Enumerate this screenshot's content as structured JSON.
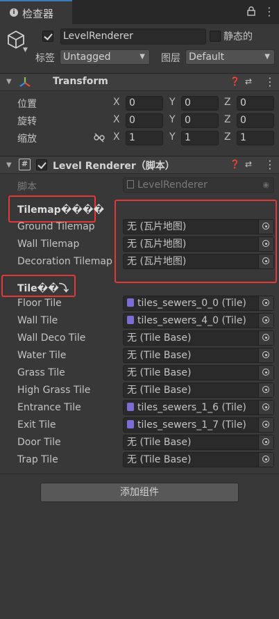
{
  "tab": {
    "title": "检查器"
  },
  "object": {
    "name": "LevelRenderer",
    "active": true,
    "static_label": "静态的",
    "tag_label": "标签",
    "tag_value": "Untagged",
    "layer_label": "图层",
    "layer_value": "Default"
  },
  "transform": {
    "title": "Transform",
    "rows": [
      {
        "label": "位置",
        "x": "0",
        "y": "0",
        "z": "0"
      },
      {
        "label": "旋转",
        "x": "0",
        "y": "0",
        "z": "0"
      },
      {
        "label": "缩放",
        "x": "1",
        "y": "1",
        "z": "1"
      }
    ]
  },
  "axis": {
    "x": "X",
    "y": "Y",
    "z": "Z"
  },
  "level_renderer": {
    "title": "Level Renderer（脚本）",
    "script_label": "脚本",
    "script_value": "LevelRenderer",
    "header_tilemap": "Tilemap����",
    "header_tile": "Tile��⤵",
    "tilemap_fields": [
      {
        "label": "Ground Tilemap",
        "value": "无 (瓦片地图)"
      },
      {
        "label": "Wall Tilemap",
        "value": "无 (瓦片地图)"
      },
      {
        "label": "Decoration Tilemap",
        "value": "无 (瓦片地图)"
      }
    ],
    "tile_fields": [
      {
        "label": "Floor Tile",
        "value": "tiles_sewers_0_0 (Tile)",
        "assigned": true
      },
      {
        "label": "Wall Tile",
        "value": "tiles_sewers_4_0 (Tile)",
        "assigned": true
      },
      {
        "label": "Wall Deco Tile",
        "value": "无 (Tile Base)",
        "assigned": false
      },
      {
        "label": "Water Tile",
        "value": "无 (Tile Base)",
        "assigned": false
      },
      {
        "label": "Grass Tile",
        "value": "无 (Tile Base)",
        "assigned": false
      },
      {
        "label": "High Grass Tile",
        "value": "无 (Tile Base)",
        "assigned": false
      },
      {
        "label": "Entrance Tile",
        "value": "tiles_sewers_1_6 (Tile)",
        "assigned": true
      },
      {
        "label": "Exit Tile",
        "value": "tiles_sewers_1_7 (Tile)",
        "assigned": true
      },
      {
        "label": "Door Tile",
        "value": "无 (Tile Base)",
        "assigned": false
      },
      {
        "label": "Trap Tile",
        "value": "无 (Tile Base)",
        "assigned": false
      }
    ]
  },
  "footer": {
    "add_component_label": "添加组件"
  },
  "colors": {
    "highlight_box": "#e03a3a",
    "tab_accent": "#3a79bb",
    "tile_icon": "#7b6dd6"
  },
  "icons": [
    "info-icon",
    "lock-icon",
    "menu-icon",
    "cube-icon",
    "transform-icon",
    "script-icon",
    "help-icon",
    "preset-icon",
    "unlink-scale-icon",
    "object-picker-icon"
  ]
}
